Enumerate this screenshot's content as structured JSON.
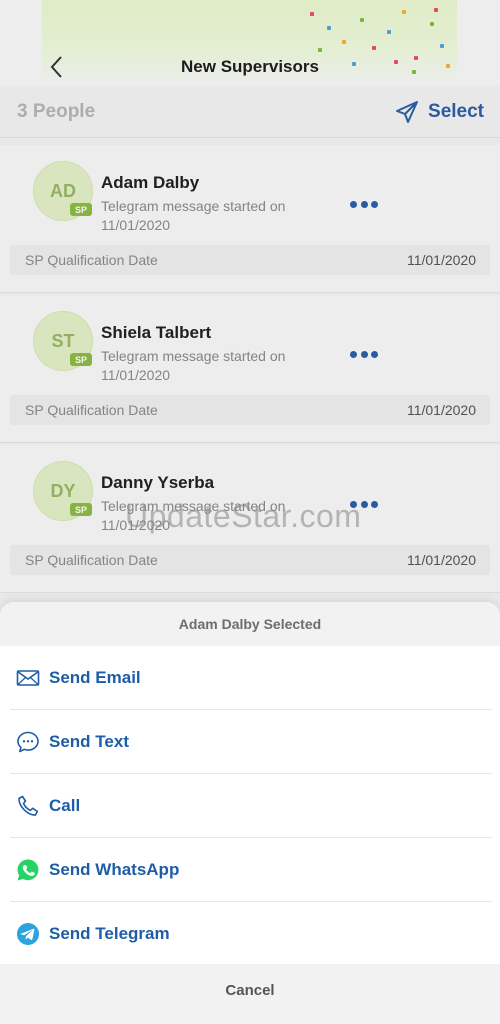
{
  "header": {
    "title": "New Supervisors"
  },
  "subheader": {
    "people_count": "3 People",
    "select_label": "Select"
  },
  "people": [
    {
      "initials": "AD",
      "badge": "SP",
      "name": "Adam Dalby",
      "message": "Telegram message started on 11/01/2020",
      "qualification_label": "SP Qualification Date",
      "qualification_date": "11/01/2020"
    },
    {
      "initials": "ST",
      "badge": "SP",
      "name": "Shiela Talbert",
      "message": "Telegram message started on 11/01/2020",
      "qualification_label": "SP Qualification Date",
      "qualification_date": "11/01/2020"
    },
    {
      "initials": "DY",
      "badge": "SP",
      "name": "Danny Yserba",
      "message": "Telegram message started on 11/01/2020",
      "qualification_label": "SP Qualification Date",
      "qualification_date": "11/01/2020"
    }
  ],
  "watermark": "UpdateStar.com",
  "action_sheet": {
    "title": "Adam Dalby Selected",
    "actions": [
      {
        "label": "Send Email",
        "icon": "mail-icon"
      },
      {
        "label": "Send Text",
        "icon": "chat-bubble-icon"
      },
      {
        "label": "Call",
        "icon": "phone-icon"
      },
      {
        "label": "Send WhatsApp",
        "icon": "whatsapp-icon"
      },
      {
        "label": "Send Telegram",
        "icon": "telegram-icon"
      }
    ],
    "cancel_label": "Cancel"
  },
  "colors": {
    "accent": "#1f5da8",
    "avatar_bg": "#e2efc7",
    "badge": "#8dbb45",
    "whatsapp": "#25d366",
    "telegram": "#2aa3de"
  }
}
